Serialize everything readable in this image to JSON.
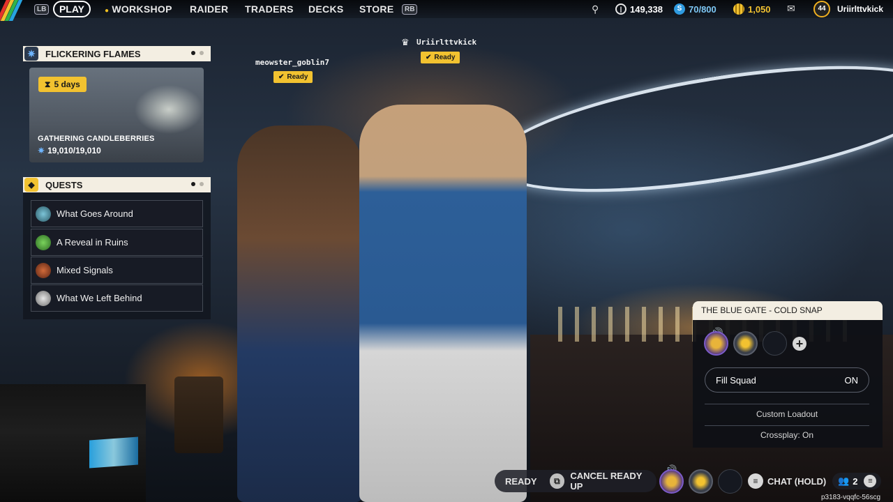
{
  "topbar": {
    "lb": "LB",
    "rb": "RB",
    "play": "PLAY",
    "nav": [
      "WORKSHOP",
      "RAIDER",
      "TRADERS",
      "DECKS",
      "STORE"
    ],
    "coins": "149,338",
    "tokens": "70/800",
    "premium": "1,050",
    "level": "44",
    "username": "Uriirlttvkick"
  },
  "event": {
    "title": "FLICKERING FLAMES",
    "timer": "5  days",
    "name": "GATHERING CANDLEBERRIES",
    "progress": "19,010/19,010"
  },
  "quests": {
    "title": "QUESTS",
    "items": [
      "What Goes Around",
      "A Reveal in Ruins",
      "Mixed Signals",
      "What We Left Behind"
    ]
  },
  "players": [
    {
      "name": "meowster_goblin7",
      "status": "Ready"
    },
    {
      "name": "Uriirlttvkick",
      "status": "Ready"
    }
  ],
  "squad": {
    "map": "THE BLUE GATE - COLD SNAP",
    "fill_label": "Fill Squad",
    "fill_value": "ON",
    "custom_loadout": "Custom Loadout",
    "crossplay": "Crossplay: On",
    "add": "+"
  },
  "bottom": {
    "ready": "READY",
    "cancel": "CANCEL READY UP",
    "chat": "CHAT (HOLD)",
    "party_count": "2",
    "session_id": "p3183-vqqfc-56scg"
  },
  "colors": {
    "accent": "#f2c230",
    "panel_head": "#f3eee2",
    "quest_bg": "#181c26"
  }
}
